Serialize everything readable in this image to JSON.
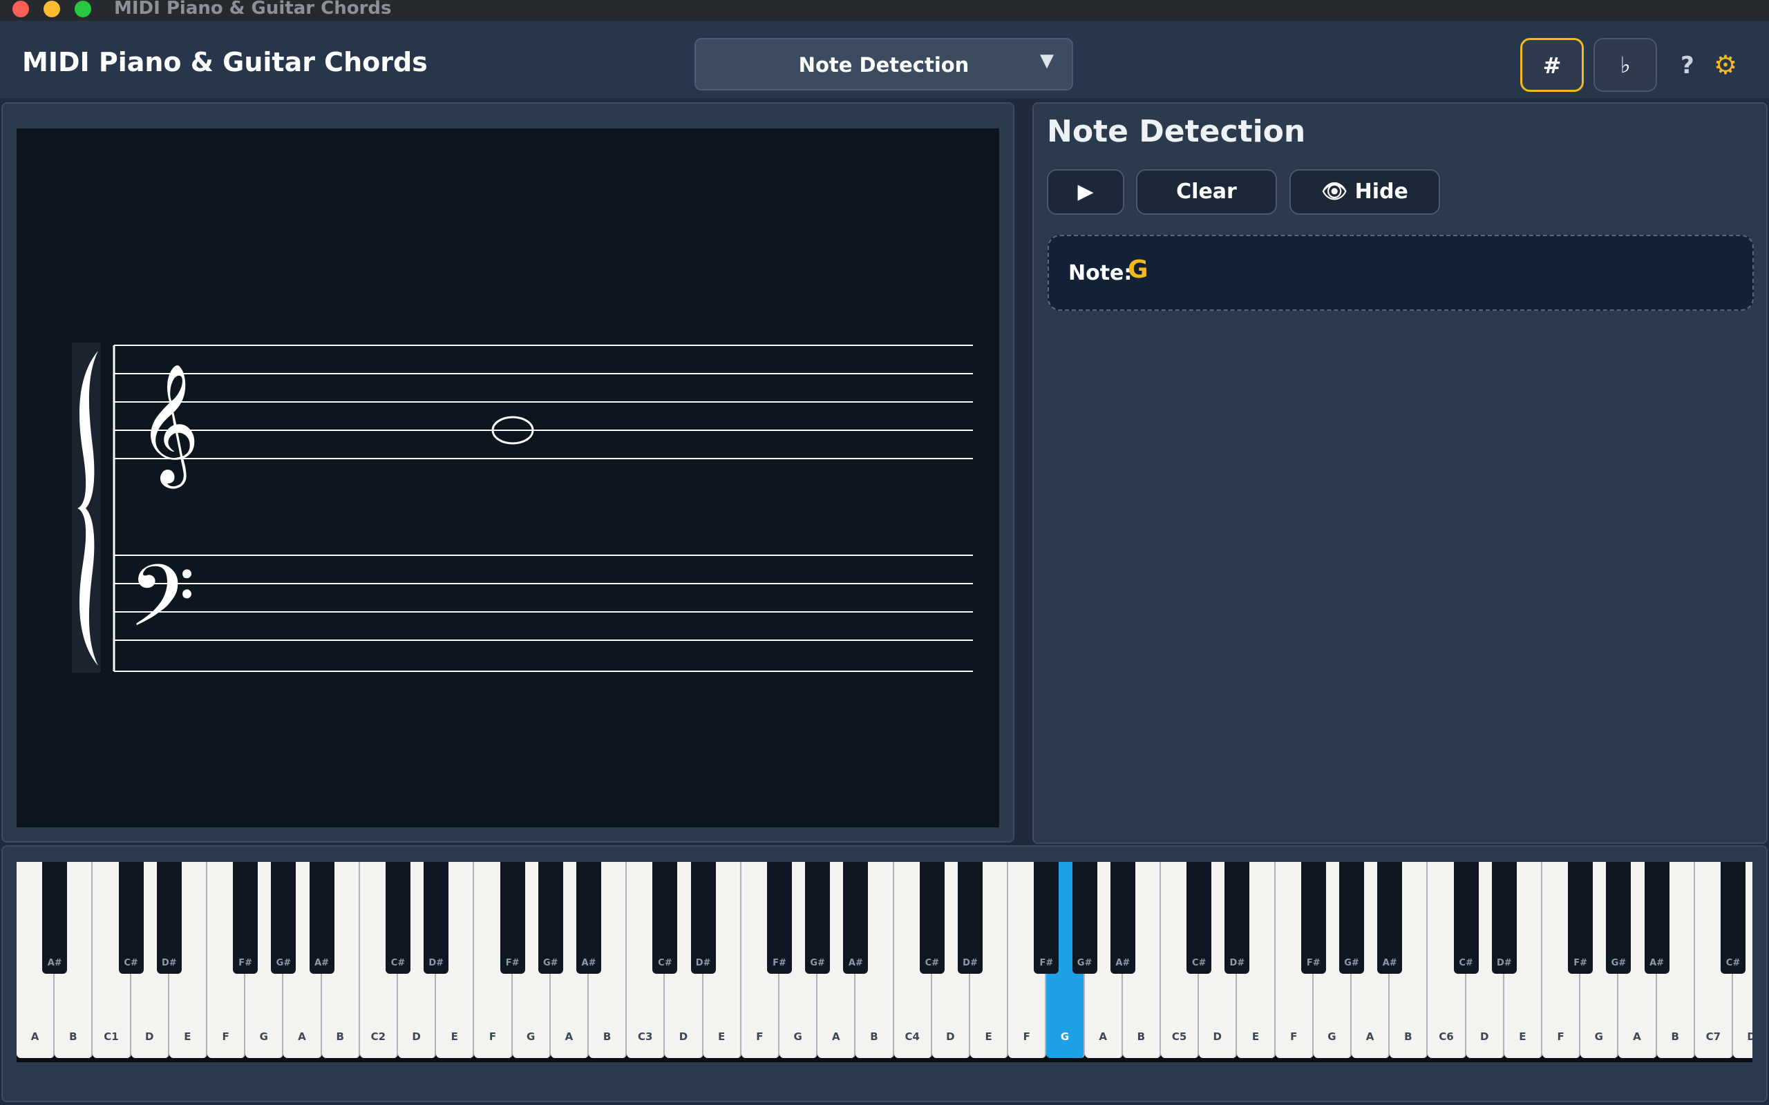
{
  "window": {
    "title": "MIDI Piano & Guitar Chords"
  },
  "header": {
    "app_title": "MIDI Piano & Guitar Chords",
    "mode": "Note Detection",
    "sharp_label": "#",
    "flat_label": "♭",
    "help_label": "?"
  },
  "detection": {
    "title": "Note Detection",
    "play_label": "▶",
    "clear_label": "Clear",
    "hide_label": "👁 Hide",
    "note_label": "Note:",
    "note_value": "G"
  },
  "staff": {
    "clefs": [
      "𝄞",
      "𝄢"
    ],
    "played_note": "G4"
  },
  "piano": {
    "white_keys": [
      "A",
      "B",
      "C1",
      "D",
      "E",
      "F",
      "G",
      "A",
      "B",
      "C2",
      "D",
      "E",
      "F",
      "G",
      "A",
      "B",
      "C3",
      "D",
      "E",
      "F",
      "G",
      "A",
      "B",
      "C4",
      "D",
      "E",
      "F",
      "G",
      "A",
      "B",
      "C5",
      "D",
      "E",
      "F",
      "G",
      "A",
      "B",
      "C6",
      "D",
      "E",
      "F",
      "G",
      "A",
      "B",
      "C7",
      "D"
    ],
    "black_keys": [
      "A#",
      "C#",
      "D#",
      "F#",
      "G#",
      "A#",
      "C#",
      "D#",
      "F#",
      "G#",
      "A#",
      "C#",
      "D#",
      "F#",
      "G#",
      "A#",
      "C#",
      "D#",
      "F#",
      "G#",
      "A#",
      "C#",
      "D#",
      "F#",
      "G#",
      "A#",
      "C#",
      "D#",
      "F#",
      "G#",
      "A#",
      "C#"
    ],
    "active_key": "G4"
  },
  "colors": {
    "accent": "#f2bb1b",
    "active_key": "#1ea0e8",
    "panel": "#2c3a4e",
    "background": "#1f2a3a"
  }
}
